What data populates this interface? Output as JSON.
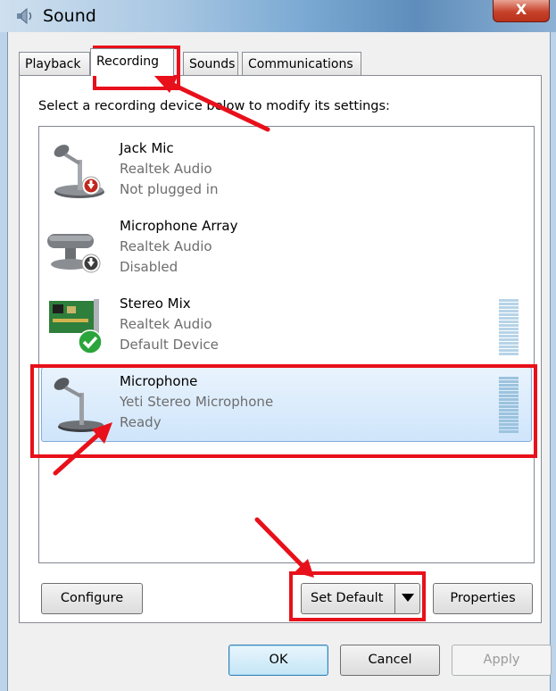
{
  "window": {
    "title": "Sound",
    "close_label": "X"
  },
  "tabs": [
    {
      "label": "Playback",
      "active": false
    },
    {
      "label": "Recording",
      "active": true
    },
    {
      "label": "Sounds",
      "active": false
    },
    {
      "label": "Communications",
      "active": false
    }
  ],
  "instruction": "Select a recording device below to modify its settings:",
  "devices": [
    {
      "name": "Jack Mic",
      "driver": "Realtek Audio",
      "status": "Not plugged in",
      "icon": "desk-microphone-icon",
      "overlay": "red-down-arrow-icon"
    },
    {
      "name": "Microphone Array",
      "driver": "Realtek Audio",
      "status": "Disabled",
      "icon": "microphone-array-icon",
      "overlay": "gray-down-arrow-icon"
    },
    {
      "name": "Stereo Mix",
      "driver": "Realtek Audio",
      "status": "Default Device",
      "icon": "sound-card-icon",
      "overlay": "green-check-icon"
    },
    {
      "name": "Microphone",
      "driver": "Yeti Stereo Microphone",
      "status": "Ready",
      "icon": "desk-microphone-icon",
      "selected": true
    }
  ],
  "buttons": {
    "configure": "Configure",
    "set_default": "Set Default",
    "properties": "Properties",
    "ok": "OK",
    "cancel": "Cancel",
    "apply": "Apply"
  },
  "colors": {
    "annotation": "#e8101a",
    "selection": "#cfe5fb",
    "meter": "#b7d4e8"
  }
}
